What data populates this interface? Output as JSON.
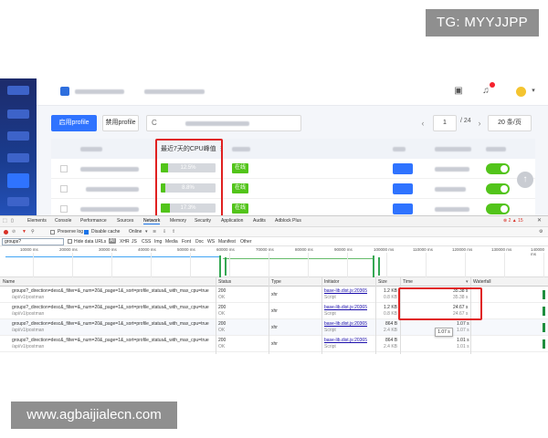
{
  "watermarks": {
    "top": "TG: MYYJJPP",
    "bottom": "www.agbaijialecn.com"
  },
  "colors": {
    "primary": "#2f73ff",
    "success": "#52c41a",
    "highlight_border": "#e02020",
    "sidebar": "#1d2b6b"
  },
  "app": {
    "toolbar": {
      "enable_label": "启用profile",
      "disable_label": "禁用profile",
      "search_prefix": "C",
      "page_current": "1",
      "page_total": "/ 24",
      "page_size": "20 条/页",
      "prev_icon": "chevron-left-icon",
      "next_icon": "chevron-right-icon"
    },
    "table": {
      "cpu_header": "最近7天的CPU峰值 ⋮",
      "rows": [
        {
          "cpu": "12.5%",
          "cpu_value": 12.5,
          "status": "在线"
        },
        {
          "cpu": "8.8%",
          "cpu_value": 8.8,
          "status": "在线"
        },
        {
          "cpu": "17.3%",
          "cpu_value": 17.3,
          "status": "在线"
        }
      ]
    }
  },
  "devtools": {
    "tabs": [
      "Elements",
      "Console",
      "Performance",
      "Sources",
      "Network",
      "Memory",
      "Security",
      "Application",
      "Audits",
      "Adblock Plus"
    ],
    "active_tab": "Network",
    "error_badge": "⊗ 2 ▲ 15",
    "close_label": "✕",
    "options": {
      "preserve_log": "Preserve log",
      "disable_cache": "Disable cache",
      "throttle": "Online"
    },
    "filter": {
      "value": "groups?",
      "hide_data_urls": "Hide data URLs",
      "all": "All",
      "types": [
        "XHR",
        "JS",
        "CSS",
        "Img",
        "Media",
        "Font",
        "Doc",
        "WS",
        "Manifest",
        "Other"
      ]
    },
    "timeline_ticks": [
      "10000 ms",
      "20000 ms",
      "30000 ms",
      "40000 ms",
      "50000 ms",
      "60000 ms",
      "70000 ms",
      "80000 ms",
      "90000 ms",
      "100000 ms",
      "110000 ms",
      "120000 ms",
      "130000 ms",
      "140000 ms"
    ],
    "columns": {
      "name": "Name",
      "status": "Status",
      "type": "Type",
      "initiator": "Initiator",
      "size": "Size",
      "time": "Time",
      "waterfall": "Waterfall"
    },
    "rows": [
      {
        "name": "groups?_direction=desc&_filter=&_num=20&_page=1&_sort=profile_status&_with_max_cpu=true",
        "path": "/api/v1/postman",
        "status": "200",
        "status_text": "OK",
        "type": "xhr",
        "initiator": "base-lib.dist.js:20365",
        "initiator_sub": "Script",
        "size": "1.2 KB",
        "size_sub": "0.8 KB",
        "time": "35.38 s",
        "time_sub": "35.38 s"
      },
      {
        "name": "groups?_direction=desc&_filter=&_num=20&_page=1&_sort=profile_status&_with_max_cpu=true",
        "path": "/api/v1/postman",
        "status": "200",
        "status_text": "OK",
        "type": "xhr",
        "initiator": "base-lib.dist.js:20365",
        "initiator_sub": "Script",
        "size": "1.2 KB",
        "size_sub": "0.8 KB",
        "time": "24.67 s",
        "time_sub": "24.67 s"
      },
      {
        "name": "groups?_direction=desc&_filter=&_num=20&_page=1&_sort=profile_status&_with_max_cpu=true",
        "path": "/api/v1/postman",
        "status": "200",
        "status_text": "OK",
        "type": "xhr",
        "initiator": "base-lib.dist.js:20365",
        "initiator_sub": "Script",
        "size": "864 B",
        "size_sub": "2.4 KB",
        "time": "1.07 s",
        "time_sub": "1.07 s"
      },
      {
        "name": "groups?_direction=desc&_filter=&_num=20&_page=1&_sort=profile_status&_with_max_cpu=true",
        "path": "/api/v1/postman",
        "status": "200",
        "status_text": "OK",
        "type": "xhr",
        "initiator": "base-lib.dist.js:20365",
        "initiator_sub": "Script",
        "size": "864 B",
        "size_sub": "2.4 KB",
        "time": "1.01 s",
        "time_sub": "1.01 s"
      }
    ],
    "tooltip": "1.07 s"
  }
}
